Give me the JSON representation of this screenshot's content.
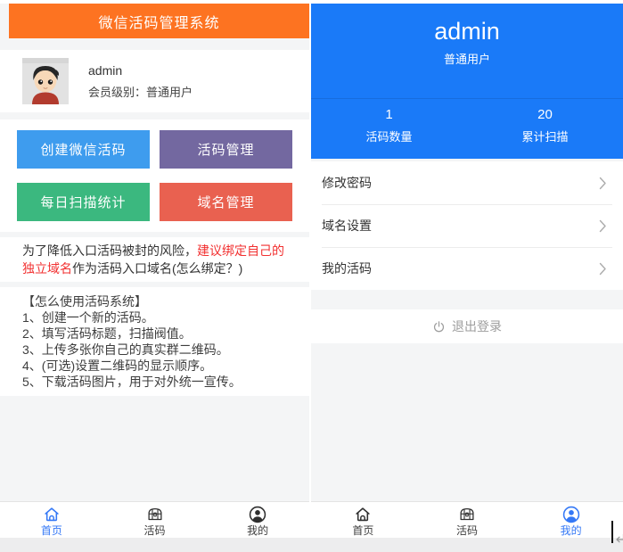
{
  "left_panel": {
    "header_title": "微信活码管理系统",
    "user": {
      "name": "admin",
      "level": "会员级别：普通用户"
    },
    "buttons": [
      {
        "label": "创建微信活码",
        "color": "#3e9cee"
      },
      {
        "label": "活码管理",
        "color": "#7368a0"
      },
      {
        "label": "每日扫描统计",
        "color": "#3bb87f"
      },
      {
        "label": "域名管理",
        "color": "#e96150"
      }
    ],
    "notice": {
      "text_before": "为了降低入口活码被封的风险，",
      "highlight": "建议绑定自己的独立域名",
      "text_after": "作为活码入口域名(怎么绑定？)"
    },
    "usage": {
      "title": "【怎么使用活码系统】",
      "steps": [
        "1、创建一个新的活码。",
        "2、填写活码标题，扫描阀值。",
        "3、上传多张你自己的真实群二维码。",
        "4、(可选)设置二维码的显示顺序。",
        "5、下载活码图片，用于对外统一宣传。"
      ]
    },
    "nav_active": "首页"
  },
  "right_panel": {
    "user_name": "admin",
    "user_level": "普通用户",
    "stats": [
      {
        "value": "1",
        "label": "活码数量"
      },
      {
        "value": "20",
        "label": "累计扫描"
      }
    ],
    "menu": [
      {
        "label": "修改密码"
      },
      {
        "label": "域名设置"
      },
      {
        "label": "我的活码"
      }
    ],
    "logout_label": "退出登录",
    "nav_active": "我的"
  },
  "nav": {
    "items": [
      {
        "label": "首页",
        "icon": "home-icon"
      },
      {
        "label": "活码",
        "icon": "chest-icon"
      },
      {
        "label": "我的",
        "icon": "person-icon"
      }
    ]
  },
  "colors": {
    "left_header_bg": "#fd7321",
    "right_header_bg": "#1a7af8",
    "nav_active": "#3478f6",
    "notice_highlight": "#f23030",
    "logout_text": "#9d9d9d",
    "button_blue": "#3e9cee",
    "button_purple": "#7368a0",
    "button_green": "#3bb87f",
    "button_red": "#e96150"
  }
}
